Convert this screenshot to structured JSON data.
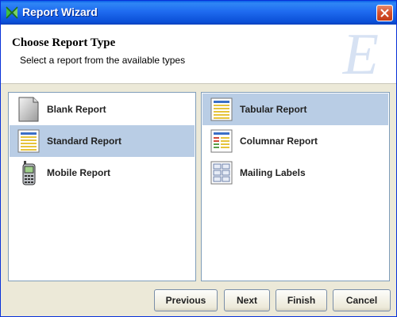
{
  "window": {
    "title": "Report Wizard"
  },
  "header": {
    "title": "Choose Report Type",
    "subtitle": "Select a report from the available types",
    "watermark": "E"
  },
  "left_list": {
    "items": [
      {
        "label": "Blank Report",
        "icon": "blank-report-icon",
        "selected": false
      },
      {
        "label": "Standard Report",
        "icon": "standard-report-icon",
        "selected": true
      },
      {
        "label": "Mobile Report",
        "icon": "mobile-report-icon",
        "selected": false
      }
    ]
  },
  "right_list": {
    "items": [
      {
        "label": "Tabular Report",
        "icon": "tabular-report-icon",
        "selected": true
      },
      {
        "label": "Columnar Report",
        "icon": "columnar-report-icon",
        "selected": false
      },
      {
        "label": "Mailing Labels",
        "icon": "mailing-labels-icon",
        "selected": false
      }
    ]
  },
  "buttons": {
    "previous": "Previous",
    "next": "Next",
    "finish": "Finish",
    "cancel": "Cancel"
  },
  "colors": {
    "titlebar": "#1f6bf0",
    "selection": "#b9cde5",
    "list_border": "#7f9db9",
    "dialog_bg": "#ece9d8"
  }
}
